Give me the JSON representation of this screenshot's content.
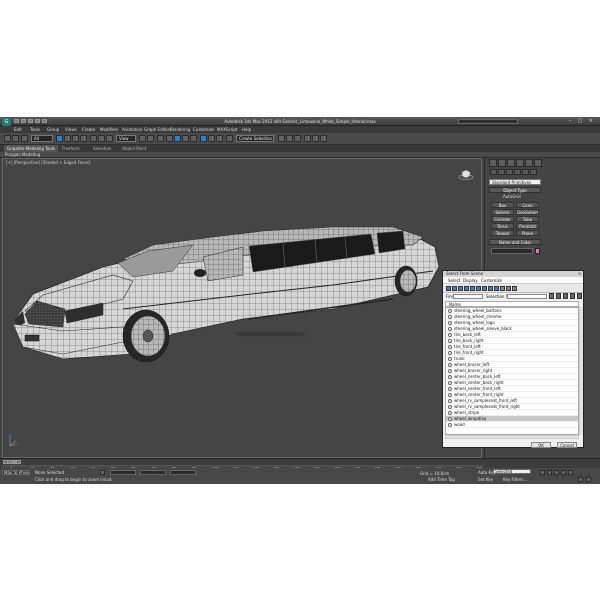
{
  "window": {
    "title": "Autodesk 3ds Max 2012 x64    Generic_Limousine_White_Simple_Interior.max",
    "logo": "G",
    "minimize": "–",
    "maximize": "□",
    "close": "×"
  },
  "menu": [
    "Edit",
    "Tools",
    "Group",
    "Views",
    "Create",
    "Modifiers",
    "Animation",
    "Graph Editors",
    "Rendering",
    "Customize",
    "MAXScript",
    "Help"
  ],
  "toolbar": {
    "selection_filter": "All",
    "view_mode": "View",
    "named_selection": "Create Selection Set"
  },
  "ribbon": {
    "tabs": [
      "Graphite Modeling Tools",
      "Freeform",
      "Selection",
      "Object Paint"
    ],
    "sub_label": "Polygon Modeling"
  },
  "viewport": {
    "label": "[+] [Perspective] [Shaded + Edged Faces]"
  },
  "command_panel": {
    "category": "Standard Primitives",
    "object_type_title": "Object Type",
    "autogrid": "AutoGrid",
    "primitives": [
      "Box",
      "Cone",
      "Sphere",
      "GeoSphere",
      "Cylinder",
      "Tube",
      "Torus",
      "Pyramid",
      "Teapot",
      "Plane"
    ],
    "name_color_title": "Name and Color"
  },
  "timeline": {
    "slider": "0 / 100",
    "ticks": [
      "0",
      "10",
      "20",
      "30",
      "40",
      "50",
      "60",
      "70",
      "80",
      "90",
      "100",
      "110",
      "120",
      "130",
      "140",
      "150",
      "160",
      "170",
      "180",
      "190",
      "200",
      "210",
      "220",
      "230"
    ]
  },
  "status": {
    "welcome": "Max to Physc",
    "selection": "None Selected",
    "prompt": "Click and drag to begin to zoom in/out",
    "grid": "Grid = 10,0cm",
    "add_time_tag": "Add Time Tag",
    "auto_key": "Auto Key",
    "auto_key_value": "Selected",
    "set_key": "Set Key",
    "key_filters": "Key Filters..."
  },
  "dialog": {
    "title": "Select From Scene",
    "close": "×",
    "menus": [
      "Select",
      "Display",
      "Customize"
    ],
    "find_label": "Find:",
    "selset_label": "Selection Set:",
    "column_header": "Name",
    "items": [
      "steering_wheel_buttons",
      "steering_wheel_chrome",
      "steering_wheel_logo",
      "steering_wheel_sleeve_black",
      "tire_back_left",
      "tire_back_right",
      "tire_front_left",
      "tire_front_right",
      "trunk",
      "wheel_bracer_left",
      "wheel_bracer_right",
      "wheel_center_back_left",
      "wheel_center_back_right",
      "wheel_center_front_left",
      "wheel_center_front_right",
      "wheel_rv_sampleseat_front_left",
      "wheel_rv_sampleseat_front_right",
      "wheel_stripe",
      "wheel_wrapdisp",
      "wood"
    ],
    "selected_index": 18,
    "ok": "OK",
    "cancel": "Cancel"
  }
}
